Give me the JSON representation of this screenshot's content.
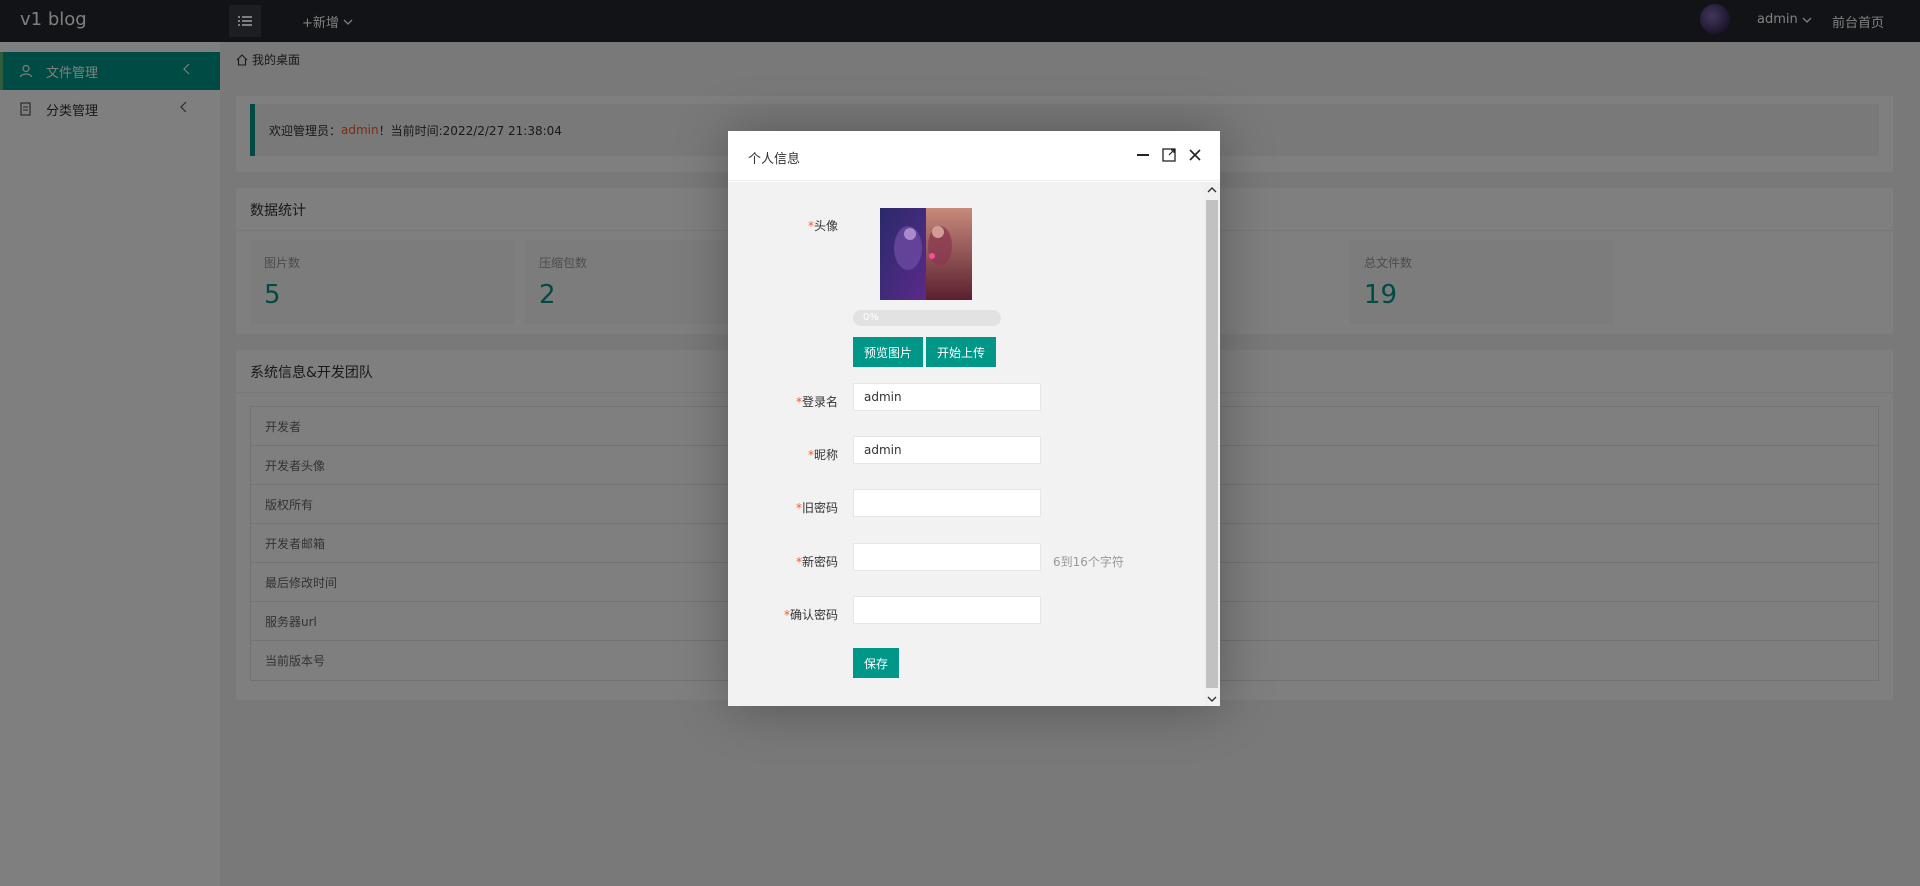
{
  "header": {
    "logo": "v1 blog",
    "add_new": "+新增",
    "user": "admin",
    "front_home": "前台首页"
  },
  "sidebar": {
    "items": [
      {
        "label": "文件管理",
        "icon": "user-icon",
        "active": true
      },
      {
        "label": "分类管理",
        "icon": "document-icon",
        "active": false
      }
    ]
  },
  "breadcrumb": "我的桌面",
  "welcome": {
    "prefix": "欢迎管理员：",
    "name": "admin",
    "suffix": "！当前时间:2022/2/27 21:38:04"
  },
  "stats": {
    "title": "数据统计",
    "items": [
      {
        "label": "图片数",
        "value": "5"
      },
      {
        "label": "压缩包数",
        "value": "2"
      },
      {
        "label": "总文件数",
        "value": "19"
      }
    ]
  },
  "sysinfo": {
    "title": "系统信息&开发团队",
    "rows": [
      "开发者",
      "开发者头像",
      "版权所有",
      "开发者邮箱",
      "最后修改时间",
      "服务器url",
      "当前版本号"
    ]
  },
  "modal": {
    "title": "个人信息",
    "avatar_label": "头像",
    "required_mark": "*",
    "progress_text": "0%",
    "progress_percent": 0,
    "preview_button": "预览图片",
    "upload_button": "开始上传",
    "login_label": "登录名",
    "login_value": "admin",
    "nickname_label": "昵称",
    "nickname_value": "admin",
    "old_pwd_label": "旧密码",
    "new_pwd_label": "新密码",
    "new_pwd_hint": "6到16个字符",
    "confirm_pwd_label": "确认密码",
    "save_button": "保存"
  },
  "colors": {
    "accent": "#009688",
    "highlight": "#FF5722",
    "topbar": "#23262e"
  }
}
